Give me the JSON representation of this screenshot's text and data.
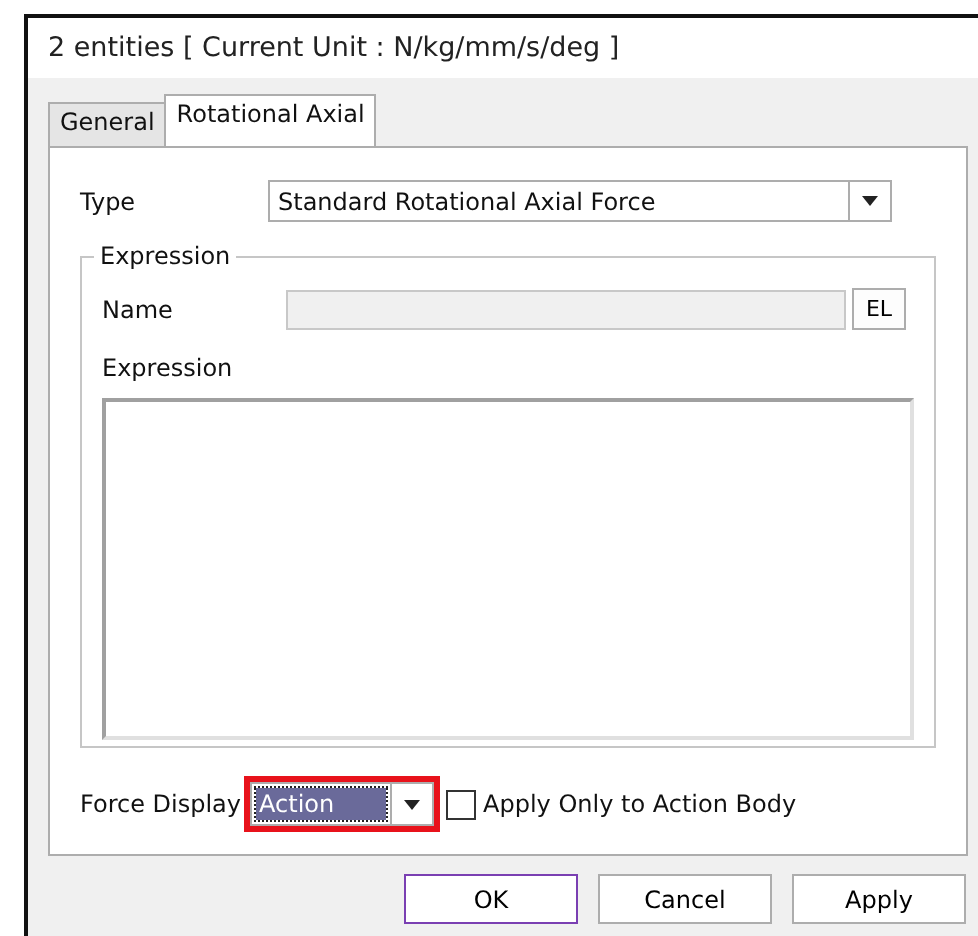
{
  "window": {
    "title": "2 entities [ Current Unit : N/kg/mm/s/deg ]"
  },
  "tabs": [
    {
      "label": "General",
      "selected": false
    },
    {
      "label": "Rotational Axial",
      "selected": true
    }
  ],
  "type_field": {
    "label": "Type",
    "value": "Standard Rotational Axial Force"
  },
  "expression_group": {
    "title": "Expression",
    "name_label": "Name",
    "name_value_disabled": true,
    "el_button": "EL",
    "expression_label": "Expression"
  },
  "force_display": {
    "label": "Force Display",
    "value": "Action",
    "highlighted": true
  },
  "apply_only_checkbox": {
    "label": "Apply Only to Action Body",
    "checked": false
  },
  "buttons": [
    {
      "label": "OK",
      "default": true
    },
    {
      "label": "Cancel",
      "default": false
    },
    {
      "label": "Apply",
      "default": false
    }
  ]
}
